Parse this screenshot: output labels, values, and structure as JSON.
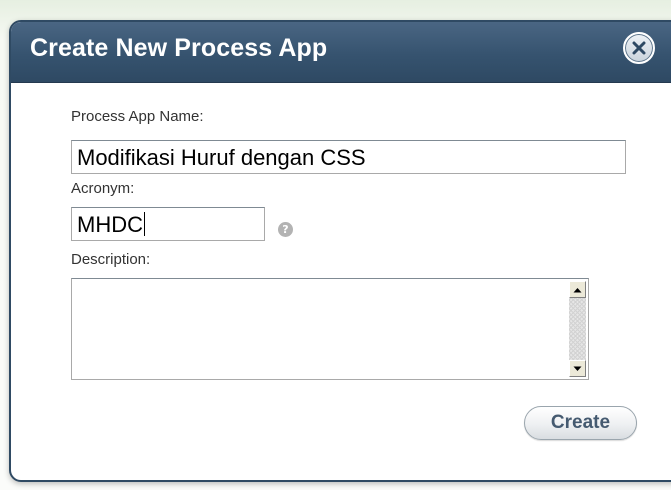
{
  "dialog": {
    "title": "Create New Process App",
    "close_icon": "close-icon"
  },
  "form": {
    "name_label": "Process App Name:",
    "name_value": "Modifikasi Huruf dengan CSS",
    "acronym_label": "Acronym:",
    "acronym_value": "MHDC",
    "help_icon": "question-mark-icon",
    "description_label": "Description:",
    "description_value": ""
  },
  "actions": {
    "create_label": "Create"
  },
  "colors": {
    "titlebar": "#36536f",
    "title_text": "#ffffff",
    "button_text": "#455a70"
  }
}
